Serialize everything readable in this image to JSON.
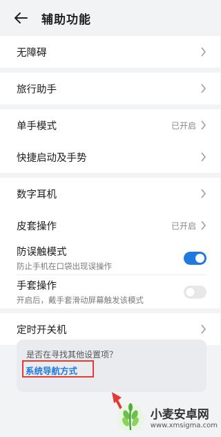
{
  "header": {
    "title": "辅助功能"
  },
  "sections": {
    "barrier_free": {
      "label": "无障碍"
    },
    "travel": {
      "label": "旅行助手"
    },
    "one_hand": {
      "label": "单手模式",
      "status": "已开启"
    },
    "shortcut": {
      "label": "快捷启动及手势"
    },
    "digital_earphone": {
      "label": "数字耳机"
    },
    "case_operation": {
      "label": "皮套操作",
      "status": "已开启"
    },
    "anti_touch": {
      "label": "防误触模式",
      "desc": "防止手机在口袋出现误操作",
      "enabled": true
    },
    "glove": {
      "label": "手套操作",
      "desc": "开启后，戴手套滑动屏幕触发该模式",
      "enabled": false
    },
    "scheduled_power": {
      "label": "定时开关机"
    }
  },
  "search_card": {
    "question": "是否在寻找其他设置项？",
    "link": "系统导航方式"
  },
  "watermark": {
    "name": "小麦安卓网",
    "url": "www.xmsigma.com"
  },
  "colors": {
    "accent": "#1f7ae0",
    "highlight": "#e53935",
    "background": "#f1f3f5"
  }
}
